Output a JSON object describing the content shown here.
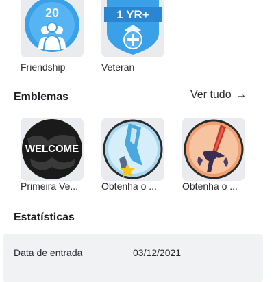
{
  "top_badges": [
    {
      "label": "Friendship",
      "icon": "friendship-badge-icon",
      "number": "20"
    },
    {
      "label": "Veteran",
      "icon": "veteran-badge-icon",
      "number": "1 YR+"
    }
  ],
  "emblems": {
    "title": "Emblemas",
    "see_all": "Ver tudo",
    "items": [
      {
        "label": "Primeira Ve...",
        "icon": "welcome-badge-icon",
        "image_text": "WELCOME"
      },
      {
        "label": "Obtenha o ...",
        "icon": "crystal-star-badge-icon"
      },
      {
        "label": "Obtenha o ...",
        "icon": "sword-badge-icon"
      }
    ]
  },
  "stats": {
    "title": "Estatísticas",
    "rows": [
      {
        "label": "Data de entrada",
        "value": "03/12/2021"
      }
    ]
  },
  "colors": {
    "accent_blue": "#3aa0e8",
    "tile_bg": "#e9ebee",
    "stats_bg": "#f1f2f4"
  }
}
